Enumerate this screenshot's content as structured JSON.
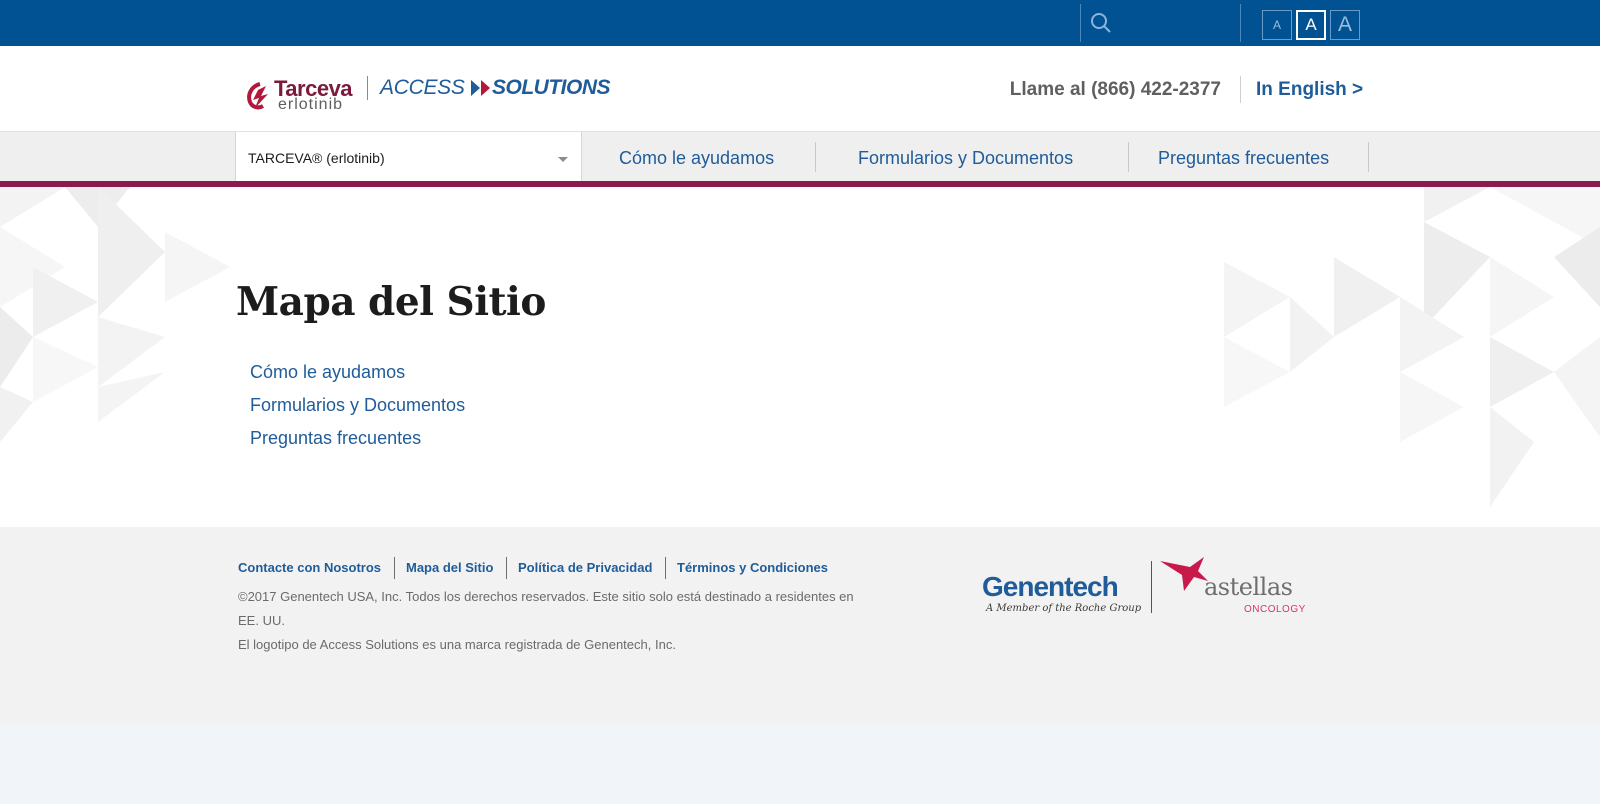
{
  "topbar": {
    "search": {
      "placeholder": ""
    },
    "font_size_buttons": [
      {
        "label": "A",
        "active": false
      },
      {
        "label": "A",
        "active": true
      },
      {
        "label": "A",
        "active": false
      }
    ]
  },
  "header": {
    "logo": {
      "brand": "Tarceva",
      "generic": "erlotinib",
      "program_part1": "ACCESS",
      "program_part2": "SOLUTIONS"
    },
    "phone": "Llame al (866) 422-2377",
    "language_link": "In English >"
  },
  "nav": {
    "product_select": {
      "value": "TARCEVA® (erlotinib)"
    },
    "items": [
      {
        "label": "Cómo le ayudamos"
      },
      {
        "label": "Formularios y Documentos"
      },
      {
        "label": "Preguntas frecuentes"
      }
    ]
  },
  "main": {
    "title": "Mapa del Sitio",
    "links": [
      {
        "label": "Cómo le ayudamos"
      },
      {
        "label": "Formularios y Documentos"
      },
      {
        "label": "Preguntas frecuentes"
      }
    ]
  },
  "footer": {
    "links": [
      {
        "label": "Contacte con Nosotros"
      },
      {
        "label": "Mapa del Sitio"
      },
      {
        "label": "Política de Privacidad"
      },
      {
        "label": "Términos y Condiciones"
      }
    ],
    "copyright_line1": "©2017 Genentech USA, Inc. Todos los derechos reservados.  Este sitio solo está destinado a residentes en",
    "copyright_line2": "EE. UU.",
    "trademark": "El logotipo de Access Solutions es una marca registrada de Genentech, Inc.",
    "genentech_name": "Genentech",
    "genentech_tagline": "A Member of the Roche Group",
    "astellas_name": "astellas",
    "astellas_division": "ONCOLOGY"
  },
  "colors": {
    "topbar": "#005293",
    "accent_bar": "#8b1b4d",
    "link": "#1f5c99"
  }
}
